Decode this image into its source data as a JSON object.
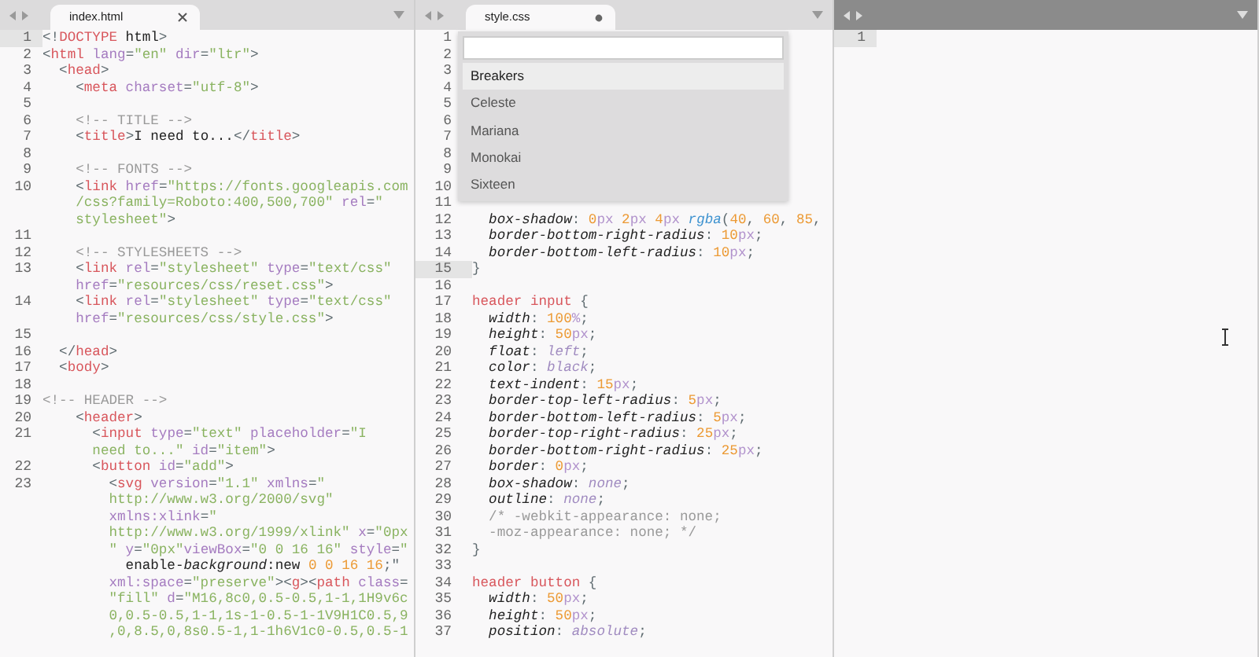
{
  "panes": [
    {
      "tab": {
        "title": "index.html",
        "modified": false
      },
      "lines": [
        {
          "number": "1",
          "current": true,
          "rows": [
            {
              "tokens": [
                {
                  "kind": "punct",
                  "text": "<!"
                },
                {
                  "kind": "tag",
                  "text": "DOCTYPE"
                },
                {
                  "kind": "text",
                  "text": " html"
                },
                {
                  "kind": "punct",
                  "text": ">"
                }
              ]
            }
          ]
        },
        {
          "number": "2",
          "current": false,
          "rows": [
            {
              "tokens": [
                {
                  "kind": "punct",
                  "text": "<"
                },
                {
                  "kind": "tag",
                  "text": "html"
                },
                {
                  "kind": "attr",
                  "text": " lang"
                },
                {
                  "kind": "punct",
                  "text": "="
                },
                {
                  "kind": "string",
                  "text": "\"en\""
                },
                {
                  "kind": "attr",
                  "text": " dir"
                },
                {
                  "kind": "punct",
                  "text": "="
                },
                {
                  "kind": "string",
                  "text": "\"ltr\""
                },
                {
                  "kind": "punct",
                  "text": ">"
                }
              ]
            }
          ]
        },
        {
          "number": "3",
          "current": false,
          "rows": [
            {
              "tokens": [
                {
                  "kind": "punct",
                  "text": "  <"
                },
                {
                  "kind": "tag",
                  "text": "head"
                },
                {
                  "kind": "punct",
                  "text": ">"
                }
              ]
            }
          ]
        },
        {
          "number": "4",
          "current": false,
          "rows": [
            {
              "tokens": [
                {
                  "kind": "punct",
                  "text": "    <"
                },
                {
                  "kind": "tag",
                  "text": "meta"
                },
                {
                  "kind": "attr",
                  "text": " charset"
                },
                {
                  "kind": "punct",
                  "text": "="
                },
                {
                  "kind": "string",
                  "text": "\"utf-8\""
                },
                {
                  "kind": "punct",
                  "text": ">"
                }
              ]
            }
          ]
        },
        {
          "number": "5",
          "current": false
        },
        {
          "number": "6",
          "current": false,
          "rows": [
            {
              "tokens": [
                {
                  "kind": "comment",
                  "text": "    <!-- TITLE -->"
                }
              ]
            }
          ]
        },
        {
          "number": "7",
          "current": false,
          "rows": [
            {
              "tokens": [
                {
                  "kind": "punct",
                  "text": "    <"
                },
                {
                  "kind": "tag",
                  "text": "title"
                },
                {
                  "kind": "punct",
                  "text": ">"
                },
                {
                  "kind": "text",
                  "text": "I need to..."
                },
                {
                  "kind": "punct",
                  "text": "</"
                },
                {
                  "kind": "tag",
                  "text": "title"
                },
                {
                  "kind": "punct",
                  "text": ">"
                }
              ]
            }
          ]
        },
        {
          "number": "8",
          "current": false
        },
        {
          "number": "9",
          "current": false,
          "rows": [
            {
              "tokens": [
                {
                  "kind": "comment",
                  "text": "    <!-- FONTS -->"
                }
              ]
            }
          ]
        },
        {
          "number": "10",
          "current": false,
          "rows": [
            {
              "tokens": [
                {
                  "kind": "punct",
                  "text": "    <"
                },
                {
                  "kind": "tag",
                  "text": "link"
                },
                {
                  "kind": "attr",
                  "text": " href"
                },
                {
                  "kind": "punct",
                  "text": "="
                },
                {
                  "kind": "string",
                  "text": "\"https://fonts.googleapis.com"
                }
              ]
            },
            {
              "tokens": [
                {
                  "kind": "string",
                  "text": "    /css?family=Roboto:400,500,700\""
                },
                {
                  "kind": "attr",
                  "text": " rel"
                },
                {
                  "kind": "punct",
                  "text": "="
                },
                {
                  "kind": "string",
                  "text": "\""
                }
              ]
            },
            {
              "tokens": [
                {
                  "kind": "string",
                  "text": "    stylesheet\""
                },
                {
                  "kind": "punct",
                  "text": ">"
                }
              ]
            }
          ]
        },
        {
          "number": "11",
          "current": false
        },
        {
          "number": "12",
          "current": false,
          "rows": [
            {
              "tokens": [
                {
                  "kind": "comment",
                  "text": "    <!-- STYLESHEETS -->"
                }
              ]
            }
          ]
        },
        {
          "number": "13",
          "current": false,
          "rows": [
            {
              "tokens": [
                {
                  "kind": "punct",
                  "text": "    <"
                },
                {
                  "kind": "tag",
                  "text": "link"
                },
                {
                  "kind": "attr",
                  "text": " rel"
                },
                {
                  "kind": "punct",
                  "text": "="
                },
                {
                  "kind": "string",
                  "text": "\"stylesheet\""
                },
                {
                  "kind": "attr",
                  "text": " type"
                },
                {
                  "kind": "punct",
                  "text": "="
                },
                {
                  "kind": "string",
                  "text": "\"text/css\""
                }
              ]
            },
            {
              "tokens": [
                {
                  "kind": "attr",
                  "text": "    href"
                },
                {
                  "kind": "punct",
                  "text": "="
                },
                {
                  "kind": "string",
                  "text": "\"resources/css/reset.css\""
                },
                {
                  "kind": "punct",
                  "text": ">"
                }
              ]
            }
          ]
        },
        {
          "number": "14",
          "current": false,
          "rows": [
            {
              "tokens": [
                {
                  "kind": "punct",
                  "text": "    <"
                },
                {
                  "kind": "tag",
                  "text": "link"
                },
                {
                  "kind": "attr",
                  "text": " rel"
                },
                {
                  "kind": "punct",
                  "text": "="
                },
                {
                  "kind": "string",
                  "text": "\"stylesheet\""
                },
                {
                  "kind": "attr",
                  "text": " type"
                },
                {
                  "kind": "punct",
                  "text": "="
                },
                {
                  "kind": "string",
                  "text": "\"text/css\""
                }
              ]
            },
            {
              "tokens": [
                {
                  "kind": "attr",
                  "text": "    href"
                },
                {
                  "kind": "punct",
                  "text": "="
                },
                {
                  "kind": "string",
                  "text": "\"resources/css/style.css\""
                },
                {
                  "kind": "punct",
                  "text": ">"
                }
              ]
            }
          ]
        },
        {
          "number": "15",
          "current": false
        },
        {
          "number": "16",
          "current": false,
          "rows": [
            {
              "tokens": [
                {
                  "kind": "punct",
                  "text": "  </"
                },
                {
                  "kind": "tag",
                  "text": "head"
                },
                {
                  "kind": "punct",
                  "text": ">"
                }
              ]
            }
          ]
        },
        {
          "number": "17",
          "current": false,
          "rows": [
            {
              "tokens": [
                {
                  "kind": "punct",
                  "text": "  <"
                },
                {
                  "kind": "tag",
                  "text": "body"
                },
                {
                  "kind": "punct",
                  "text": ">"
                }
              ]
            }
          ]
        },
        {
          "number": "18",
          "current": false
        },
        {
          "number": "19",
          "current": false,
          "rows": [
            {
              "tokens": [
                {
                  "kind": "comment",
                  "text": "<!-- HEADER -->"
                }
              ]
            }
          ]
        },
        {
          "number": "20",
          "current": false,
          "rows": [
            {
              "tokens": [
                {
                  "kind": "punct",
                  "text": "    <"
                },
                {
                  "kind": "tag",
                  "text": "header"
                },
                {
                  "kind": "punct",
                  "text": ">"
                }
              ]
            }
          ]
        },
        {
          "number": "21",
          "current": false,
          "rows": [
            {
              "tokens": [
                {
                  "kind": "punct",
                  "text": "      <"
                },
                {
                  "kind": "tag",
                  "text": "input"
                },
                {
                  "kind": "attr",
                  "text": " type"
                },
                {
                  "kind": "punct",
                  "text": "="
                },
                {
                  "kind": "string",
                  "text": "\"text\""
                },
                {
                  "kind": "attr",
                  "text": " placeholder"
                },
                {
                  "kind": "punct",
                  "text": "="
                },
                {
                  "kind": "string",
                  "text": "\"I"
                }
              ]
            },
            {
              "tokens": [
                {
                  "kind": "string",
                  "text": "      need to...\""
                },
                {
                  "kind": "attr",
                  "text": " id"
                },
                {
                  "kind": "punct",
                  "text": "="
                },
                {
                  "kind": "string",
                  "text": "\"item\""
                },
                {
                  "kind": "punct",
                  "text": ">"
                }
              ]
            }
          ]
        },
        {
          "number": "22",
          "current": false,
          "rows": [
            {
              "tokens": [
                {
                  "kind": "punct",
                  "text": "      <"
                },
                {
                  "kind": "tag",
                  "text": "button"
                },
                {
                  "kind": "attr",
                  "text": " id"
                },
                {
                  "kind": "punct",
                  "text": "="
                },
                {
                  "kind": "string",
                  "text": "\"add\""
                },
                {
                  "kind": "punct",
                  "text": ">"
                }
              ]
            }
          ]
        },
        {
          "number": "23",
          "current": false,
          "rows": [
            {
              "tokens": [
                {
                  "kind": "punct",
                  "text": "        <"
                },
                {
                  "kind": "tag",
                  "text": "svg"
                },
                {
                  "kind": "attr",
                  "text": " version"
                },
                {
                  "kind": "punct",
                  "text": "="
                },
                {
                  "kind": "string",
                  "text": "\"1.1\""
                },
                {
                  "kind": "attr",
                  "text": " xmlns"
                },
                {
                  "kind": "punct",
                  "text": "="
                },
                {
                  "kind": "string",
                  "text": "\""
                }
              ]
            },
            {
              "tokens": [
                {
                  "kind": "string",
                  "text": "        http://www.w3.org/2000/svg\""
                }
              ]
            },
            {
              "tokens": [
                {
                  "kind": "attr",
                  "text": "        xmlns:xlink"
                },
                {
                  "kind": "punct",
                  "text": "="
                },
                {
                  "kind": "string",
                  "text": "\""
                }
              ]
            },
            {
              "tokens": [
                {
                  "kind": "string",
                  "text": "        http://www.w3.org/1999/xlink\""
                },
                {
                  "kind": "attr",
                  "text": " x"
                },
                {
                  "kind": "punct",
                  "text": "="
                },
                {
                  "kind": "string",
                  "text": "\"0px"
                }
              ]
            },
            {
              "tokens": [
                {
                  "kind": "string",
                  "text": "        \""
                },
                {
                  "kind": "attr",
                  "text": " y"
                },
                {
                  "kind": "punct",
                  "text": "="
                },
                {
                  "kind": "string",
                  "text": "\"0px\""
                },
                {
                  "kind": "attr",
                  "text": "viewBox"
                },
                {
                  "kind": "punct",
                  "text": "="
                },
                {
                  "kind": "string",
                  "text": "\"0 0 16 16\""
                },
                {
                  "kind": "attr",
                  "text": " style"
                },
                {
                  "kind": "punct",
                  "text": "="
                },
                {
                  "kind": "string",
                  "text": "\""
                }
              ]
            },
            {
              "tokens": [
                {
                  "kind": "text",
                  "text": "          enable-"
                },
                {
                  "kind": "property",
                  "text": "background"
                },
                {
                  "kind": "text",
                  "text": ":new "
                },
                {
                  "kind": "number",
                  "text": "0 0 16 16"
                },
                {
                  "kind": "punct",
                  "text": ";\""
                }
              ]
            },
            {
              "tokens": [
                {
                  "kind": "attr",
                  "text": "        xml:space"
                },
                {
                  "kind": "punct",
                  "text": "="
                },
                {
                  "kind": "string",
                  "text": "\"preserve\""
                },
                {
                  "kind": "punct",
                  "text": "><"
                },
                {
                  "kind": "tag",
                  "text": "g"
                },
                {
                  "kind": "punct",
                  "text": "><"
                },
                {
                  "kind": "tag",
                  "text": "path"
                },
                {
                  "kind": "attr",
                  "text": " class"
                },
                {
                  "kind": "punct",
                  "text": "="
                }
              ]
            },
            {
              "tokens": [
                {
                  "kind": "string",
                  "text": "        \"fill\""
                },
                {
                  "kind": "attr",
                  "text": " d"
                },
                {
                  "kind": "punct",
                  "text": "="
                },
                {
                  "kind": "string",
                  "text": "\"M16,8c0,0.5-0.5,1-1,1H9v6c"
                }
              ]
            },
            {
              "tokens": [
                {
                  "kind": "string",
                  "text": "        0,0.5-0.5,1-1,1s-1-0.5-1-1V9H1C0.5,9"
                }
              ]
            },
            {
              "tokens": [
                {
                  "kind": "string",
                  "text": "        ,0,8.5,0,8s0.5-1,1-1h6V1c0-0.5,0.5-1"
                }
              ]
            }
          ]
        }
      ]
    },
    {
      "tab": {
        "title": "style.css",
        "modified": true
      },
      "popup": {
        "items": [
          {
            "label": "Breakers",
            "selected": true
          },
          {
            "label": "Celeste",
            "selected": false
          },
          {
            "label": "Mariana",
            "selected": false
          },
          {
            "label": "Monokai",
            "selected": false
          },
          {
            "label": "Sixteen",
            "selected": false
          }
        ]
      },
      "lines": [
        {
          "number": "1",
          "current": false
        },
        {
          "number": "2",
          "current": false
        },
        {
          "number": "3",
          "current": false
        },
        {
          "number": "4",
          "current": false
        },
        {
          "number": "5",
          "current": false
        },
        {
          "number": "6",
          "current": false
        },
        {
          "number": "7",
          "current": false
        },
        {
          "number": "8",
          "current": false
        },
        {
          "number": "9",
          "current": false
        },
        {
          "number": "10",
          "current": false
        },
        {
          "number": "11",
          "current": false
        },
        {
          "number": "12",
          "current": false,
          "rows": [
            {
              "tokens": [
                {
                  "kind": "property",
                  "text": "  box-shadow"
                },
                {
                  "kind": "punct",
                  "text": ": "
                },
                {
                  "kind": "number",
                  "text": "0"
                },
                {
                  "kind": "unit",
                  "text": "px"
                },
                {
                  "kind": "number",
                  "text": " 2"
                },
                {
                  "kind": "unit",
                  "text": "px"
                },
                {
                  "kind": "number",
                  "text": " 4"
                },
                {
                  "kind": "unit",
                  "text": "px"
                },
                {
                  "kind": "function",
                  "text": " rgba"
                },
                {
                  "kind": "punct",
                  "text": "("
                },
                {
                  "kind": "number",
                  "text": "40"
                },
                {
                  "kind": "punct",
                  "text": ", "
                },
                {
                  "kind": "number",
                  "text": "60"
                },
                {
                  "kind": "punct",
                  "text": ", "
                },
                {
                  "kind": "number",
                  "text": "85"
                },
                {
                  "kind": "punct",
                  "text": ","
                }
              ]
            }
          ]
        },
        {
          "number": "13",
          "current": false,
          "rows": [
            {
              "tokens": [
                {
                  "kind": "property",
                  "text": "  border-bottom-right-radius"
                },
                {
                  "kind": "punct",
                  "text": ": "
                },
                {
                  "kind": "number",
                  "text": "10"
                },
                {
                  "kind": "unit",
                  "text": "px"
                },
                {
                  "kind": "punct",
                  "text": ";"
                }
              ]
            }
          ]
        },
        {
          "number": "14",
          "current": false,
          "rows": [
            {
              "tokens": [
                {
                  "kind": "property",
                  "text": "  border-bottom-left-radius"
                },
                {
                  "kind": "punct",
                  "text": ": "
                },
                {
                  "kind": "number",
                  "text": "10"
                },
                {
                  "kind": "unit",
                  "text": "px"
                },
                {
                  "kind": "punct",
                  "text": ";"
                }
              ]
            }
          ]
        },
        {
          "number": "15",
          "current": true,
          "rows": [
            {
              "tokens": [
                {
                  "kind": "punct",
                  "text": "}"
                }
              ]
            }
          ]
        },
        {
          "number": "16",
          "current": false
        },
        {
          "number": "17",
          "current": false,
          "rows": [
            {
              "tokens": [
                {
                  "kind": "selector",
                  "text": "header input"
                },
                {
                  "kind": "punct",
                  "text": " {"
                }
              ]
            }
          ]
        },
        {
          "number": "18",
          "current": false,
          "rows": [
            {
              "tokens": [
                {
                  "kind": "property",
                  "text": "  width"
                },
                {
                  "kind": "punct",
                  "text": ": "
                },
                {
                  "kind": "number",
                  "text": "100"
                },
                {
                  "kind": "unit",
                  "text": "%"
                },
                {
                  "kind": "punct",
                  "text": ";"
                }
              ]
            }
          ]
        },
        {
          "number": "19",
          "current": false,
          "rows": [
            {
              "tokens": [
                {
                  "kind": "property",
                  "text": "  height"
                },
                {
                  "kind": "punct",
                  "text": ": "
                },
                {
                  "kind": "number",
                  "text": "50"
                },
                {
                  "kind": "unit",
                  "text": "px"
                },
                {
                  "kind": "punct",
                  "text": ";"
                }
              ]
            }
          ]
        },
        {
          "number": "20",
          "current": false,
          "rows": [
            {
              "tokens": [
                {
                  "kind": "property",
                  "text": "  float"
                },
                {
                  "kind": "punct",
                  "text": ": "
                },
                {
                  "kind": "keyword",
                  "text": "left"
                },
                {
                  "kind": "punct",
                  "text": ";"
                }
              ]
            }
          ]
        },
        {
          "number": "21",
          "current": false,
          "rows": [
            {
              "tokens": [
                {
                  "kind": "property",
                  "text": "  color"
                },
                {
                  "kind": "punct",
                  "text": ": "
                },
                {
                  "kind": "keyword",
                  "text": "black"
                },
                {
                  "kind": "punct",
                  "text": ";"
                }
              ]
            }
          ]
        },
        {
          "number": "22",
          "current": false,
          "rows": [
            {
              "tokens": [
                {
                  "kind": "property",
                  "text": "  text-indent"
                },
                {
                  "kind": "punct",
                  "text": ": "
                },
                {
                  "kind": "number",
                  "text": "15"
                },
                {
                  "kind": "unit",
                  "text": "px"
                },
                {
                  "kind": "punct",
                  "text": ";"
                }
              ]
            }
          ]
        },
        {
          "number": "23",
          "current": false,
          "rows": [
            {
              "tokens": [
                {
                  "kind": "property",
                  "text": "  border-top-left-radius"
                },
                {
                  "kind": "punct",
                  "text": ": "
                },
                {
                  "kind": "number",
                  "text": "5"
                },
                {
                  "kind": "unit",
                  "text": "px"
                },
                {
                  "kind": "punct",
                  "text": ";"
                }
              ]
            }
          ]
        },
        {
          "number": "24",
          "current": false,
          "rows": [
            {
              "tokens": [
                {
                  "kind": "property",
                  "text": "  border-bottom-left-radius"
                },
                {
                  "kind": "punct",
                  "text": ": "
                },
                {
                  "kind": "number",
                  "text": "5"
                },
                {
                  "kind": "unit",
                  "text": "px"
                },
                {
                  "kind": "punct",
                  "text": ";"
                }
              ]
            }
          ]
        },
        {
          "number": "25",
          "current": false,
          "rows": [
            {
              "tokens": [
                {
                  "kind": "property",
                  "text": "  border-top-right-radius"
                },
                {
                  "kind": "punct",
                  "text": ": "
                },
                {
                  "kind": "number",
                  "text": "25"
                },
                {
                  "kind": "unit",
                  "text": "px"
                },
                {
                  "kind": "punct",
                  "text": ";"
                }
              ]
            }
          ]
        },
        {
          "number": "26",
          "current": false,
          "rows": [
            {
              "tokens": [
                {
                  "kind": "property",
                  "text": "  border-bottom-right-radius"
                },
                {
                  "kind": "punct",
                  "text": ": "
                },
                {
                  "kind": "number",
                  "text": "25"
                },
                {
                  "kind": "unit",
                  "text": "px"
                },
                {
                  "kind": "punct",
                  "text": ";"
                }
              ]
            }
          ]
        },
        {
          "number": "27",
          "current": false,
          "rows": [
            {
              "tokens": [
                {
                  "kind": "property",
                  "text": "  border"
                },
                {
                  "kind": "punct",
                  "text": ": "
                },
                {
                  "kind": "number",
                  "text": "0"
                },
                {
                  "kind": "unit",
                  "text": "px"
                },
                {
                  "kind": "punct",
                  "text": ";"
                }
              ]
            }
          ]
        },
        {
          "number": "28",
          "current": false,
          "rows": [
            {
              "tokens": [
                {
                  "kind": "property",
                  "text": "  box-shadow"
                },
                {
                  "kind": "punct",
                  "text": ": "
                },
                {
                  "kind": "keyword",
                  "text": "none"
                },
                {
                  "kind": "punct",
                  "text": ";"
                }
              ]
            }
          ]
        },
        {
          "number": "29",
          "current": false,
          "rows": [
            {
              "tokens": [
                {
                  "kind": "property",
                  "text": "  outline"
                },
                {
                  "kind": "punct",
                  "text": ": "
                },
                {
                  "kind": "keyword",
                  "text": "none"
                },
                {
                  "kind": "punct",
                  "text": ";"
                }
              ]
            }
          ]
        },
        {
          "number": "30",
          "current": false,
          "rows": [
            {
              "tokens": [
                {
                  "kind": "comment",
                  "text": "  /* -webkit-appearance: none;"
                }
              ]
            }
          ]
        },
        {
          "number": "31",
          "current": false,
          "rows": [
            {
              "tokens": [
                {
                  "kind": "comment",
                  "text": "  -moz-appearance: none; */"
                }
              ]
            }
          ]
        },
        {
          "number": "32",
          "current": false,
          "rows": [
            {
              "tokens": [
                {
                  "kind": "punct",
                  "text": "}"
                }
              ]
            }
          ]
        },
        {
          "number": "33",
          "current": false
        },
        {
          "number": "34",
          "current": false,
          "rows": [
            {
              "tokens": [
                {
                  "kind": "selector",
                  "text": "header button"
                },
                {
                  "kind": "punct",
                  "text": " {"
                }
              ]
            }
          ]
        },
        {
          "number": "35",
          "current": false,
          "rows": [
            {
              "tokens": [
                {
                  "kind": "property",
                  "text": "  width"
                },
                {
                  "kind": "punct",
                  "text": ": "
                },
                {
                  "kind": "number",
                  "text": "50"
                },
                {
                  "kind": "unit",
                  "text": "px"
                },
                {
                  "kind": "punct",
                  "text": ";"
                }
              ]
            }
          ]
        },
        {
          "number": "36",
          "current": false,
          "rows": [
            {
              "tokens": [
                {
                  "kind": "property",
                  "text": "  height"
                },
                {
                  "kind": "punct",
                  "text": ": "
                },
                {
                  "kind": "number",
                  "text": "50"
                },
                {
                  "kind": "unit",
                  "text": "px"
                },
                {
                  "kind": "punct",
                  "text": ";"
                }
              ]
            }
          ]
        },
        {
          "number": "37",
          "current": false,
          "rows": [
            {
              "tokens": [
                {
                  "kind": "property",
                  "text": "  position"
                },
                {
                  "kind": "punct",
                  "text": ": "
                },
                {
                  "kind": "keyword",
                  "text": "absolute"
                },
                {
                  "kind": "punct",
                  "text": ";"
                }
              ]
            }
          ]
        }
      ]
    },
    {
      "lines": [
        {
          "number": "1",
          "current": true
        }
      ]
    }
  ]
}
